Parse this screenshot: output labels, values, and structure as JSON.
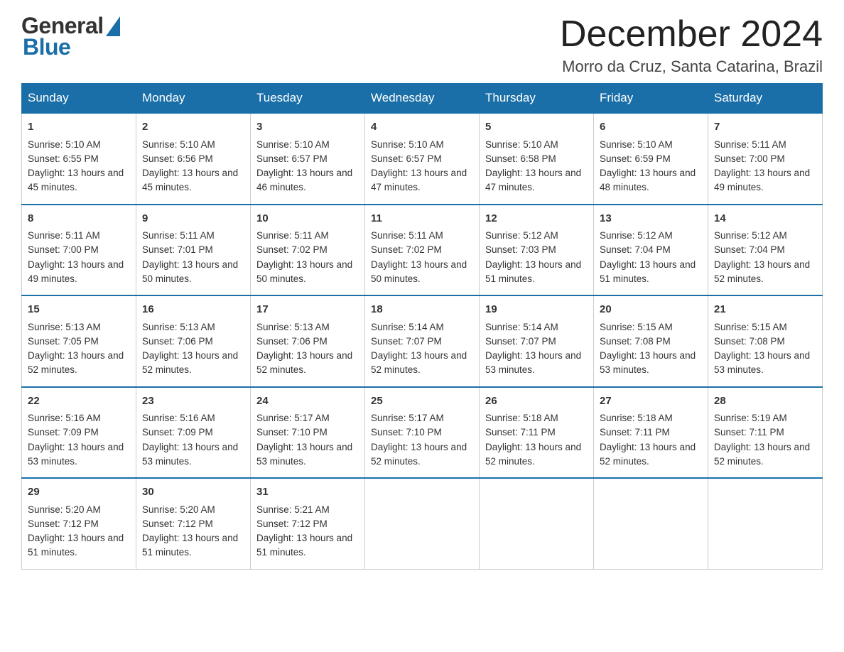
{
  "header": {
    "logo_general": "General",
    "logo_blue": "Blue",
    "month_title": "December 2024",
    "location": "Morro da Cruz, Santa Catarina, Brazil"
  },
  "days_of_week": [
    "Sunday",
    "Monday",
    "Tuesday",
    "Wednesday",
    "Thursday",
    "Friday",
    "Saturday"
  ],
  "weeks": [
    [
      {
        "day": "1",
        "sunrise": "5:10 AM",
        "sunset": "6:55 PM",
        "daylight": "13 hours and 45 minutes."
      },
      {
        "day": "2",
        "sunrise": "5:10 AM",
        "sunset": "6:56 PM",
        "daylight": "13 hours and 45 minutes."
      },
      {
        "day": "3",
        "sunrise": "5:10 AM",
        "sunset": "6:57 PM",
        "daylight": "13 hours and 46 minutes."
      },
      {
        "day": "4",
        "sunrise": "5:10 AM",
        "sunset": "6:57 PM",
        "daylight": "13 hours and 47 minutes."
      },
      {
        "day": "5",
        "sunrise": "5:10 AM",
        "sunset": "6:58 PM",
        "daylight": "13 hours and 47 minutes."
      },
      {
        "day": "6",
        "sunrise": "5:10 AM",
        "sunset": "6:59 PM",
        "daylight": "13 hours and 48 minutes."
      },
      {
        "day": "7",
        "sunrise": "5:11 AM",
        "sunset": "7:00 PM",
        "daylight": "13 hours and 49 minutes."
      }
    ],
    [
      {
        "day": "8",
        "sunrise": "5:11 AM",
        "sunset": "7:00 PM",
        "daylight": "13 hours and 49 minutes."
      },
      {
        "day": "9",
        "sunrise": "5:11 AM",
        "sunset": "7:01 PM",
        "daylight": "13 hours and 50 minutes."
      },
      {
        "day": "10",
        "sunrise": "5:11 AM",
        "sunset": "7:02 PM",
        "daylight": "13 hours and 50 minutes."
      },
      {
        "day": "11",
        "sunrise": "5:11 AM",
        "sunset": "7:02 PM",
        "daylight": "13 hours and 50 minutes."
      },
      {
        "day": "12",
        "sunrise": "5:12 AM",
        "sunset": "7:03 PM",
        "daylight": "13 hours and 51 minutes."
      },
      {
        "day": "13",
        "sunrise": "5:12 AM",
        "sunset": "7:04 PM",
        "daylight": "13 hours and 51 minutes."
      },
      {
        "day": "14",
        "sunrise": "5:12 AM",
        "sunset": "7:04 PM",
        "daylight": "13 hours and 52 minutes."
      }
    ],
    [
      {
        "day": "15",
        "sunrise": "5:13 AM",
        "sunset": "7:05 PM",
        "daylight": "13 hours and 52 minutes."
      },
      {
        "day": "16",
        "sunrise": "5:13 AM",
        "sunset": "7:06 PM",
        "daylight": "13 hours and 52 minutes."
      },
      {
        "day": "17",
        "sunrise": "5:13 AM",
        "sunset": "7:06 PM",
        "daylight": "13 hours and 52 minutes."
      },
      {
        "day": "18",
        "sunrise": "5:14 AM",
        "sunset": "7:07 PM",
        "daylight": "13 hours and 52 minutes."
      },
      {
        "day": "19",
        "sunrise": "5:14 AM",
        "sunset": "7:07 PM",
        "daylight": "13 hours and 53 minutes."
      },
      {
        "day": "20",
        "sunrise": "5:15 AM",
        "sunset": "7:08 PM",
        "daylight": "13 hours and 53 minutes."
      },
      {
        "day": "21",
        "sunrise": "5:15 AM",
        "sunset": "7:08 PM",
        "daylight": "13 hours and 53 minutes."
      }
    ],
    [
      {
        "day": "22",
        "sunrise": "5:16 AM",
        "sunset": "7:09 PM",
        "daylight": "13 hours and 53 minutes."
      },
      {
        "day": "23",
        "sunrise": "5:16 AM",
        "sunset": "7:09 PM",
        "daylight": "13 hours and 53 minutes."
      },
      {
        "day": "24",
        "sunrise": "5:17 AM",
        "sunset": "7:10 PM",
        "daylight": "13 hours and 53 minutes."
      },
      {
        "day": "25",
        "sunrise": "5:17 AM",
        "sunset": "7:10 PM",
        "daylight": "13 hours and 52 minutes."
      },
      {
        "day": "26",
        "sunrise": "5:18 AM",
        "sunset": "7:11 PM",
        "daylight": "13 hours and 52 minutes."
      },
      {
        "day": "27",
        "sunrise": "5:18 AM",
        "sunset": "7:11 PM",
        "daylight": "13 hours and 52 minutes."
      },
      {
        "day": "28",
        "sunrise": "5:19 AM",
        "sunset": "7:11 PM",
        "daylight": "13 hours and 52 minutes."
      }
    ],
    [
      {
        "day": "29",
        "sunrise": "5:20 AM",
        "sunset": "7:12 PM",
        "daylight": "13 hours and 51 minutes."
      },
      {
        "day": "30",
        "sunrise": "5:20 AM",
        "sunset": "7:12 PM",
        "daylight": "13 hours and 51 minutes."
      },
      {
        "day": "31",
        "sunrise": "5:21 AM",
        "sunset": "7:12 PM",
        "daylight": "13 hours and 51 minutes."
      },
      null,
      null,
      null,
      null
    ]
  ],
  "labels": {
    "sunrise": "Sunrise:",
    "sunset": "Sunset:",
    "daylight": "Daylight:"
  }
}
